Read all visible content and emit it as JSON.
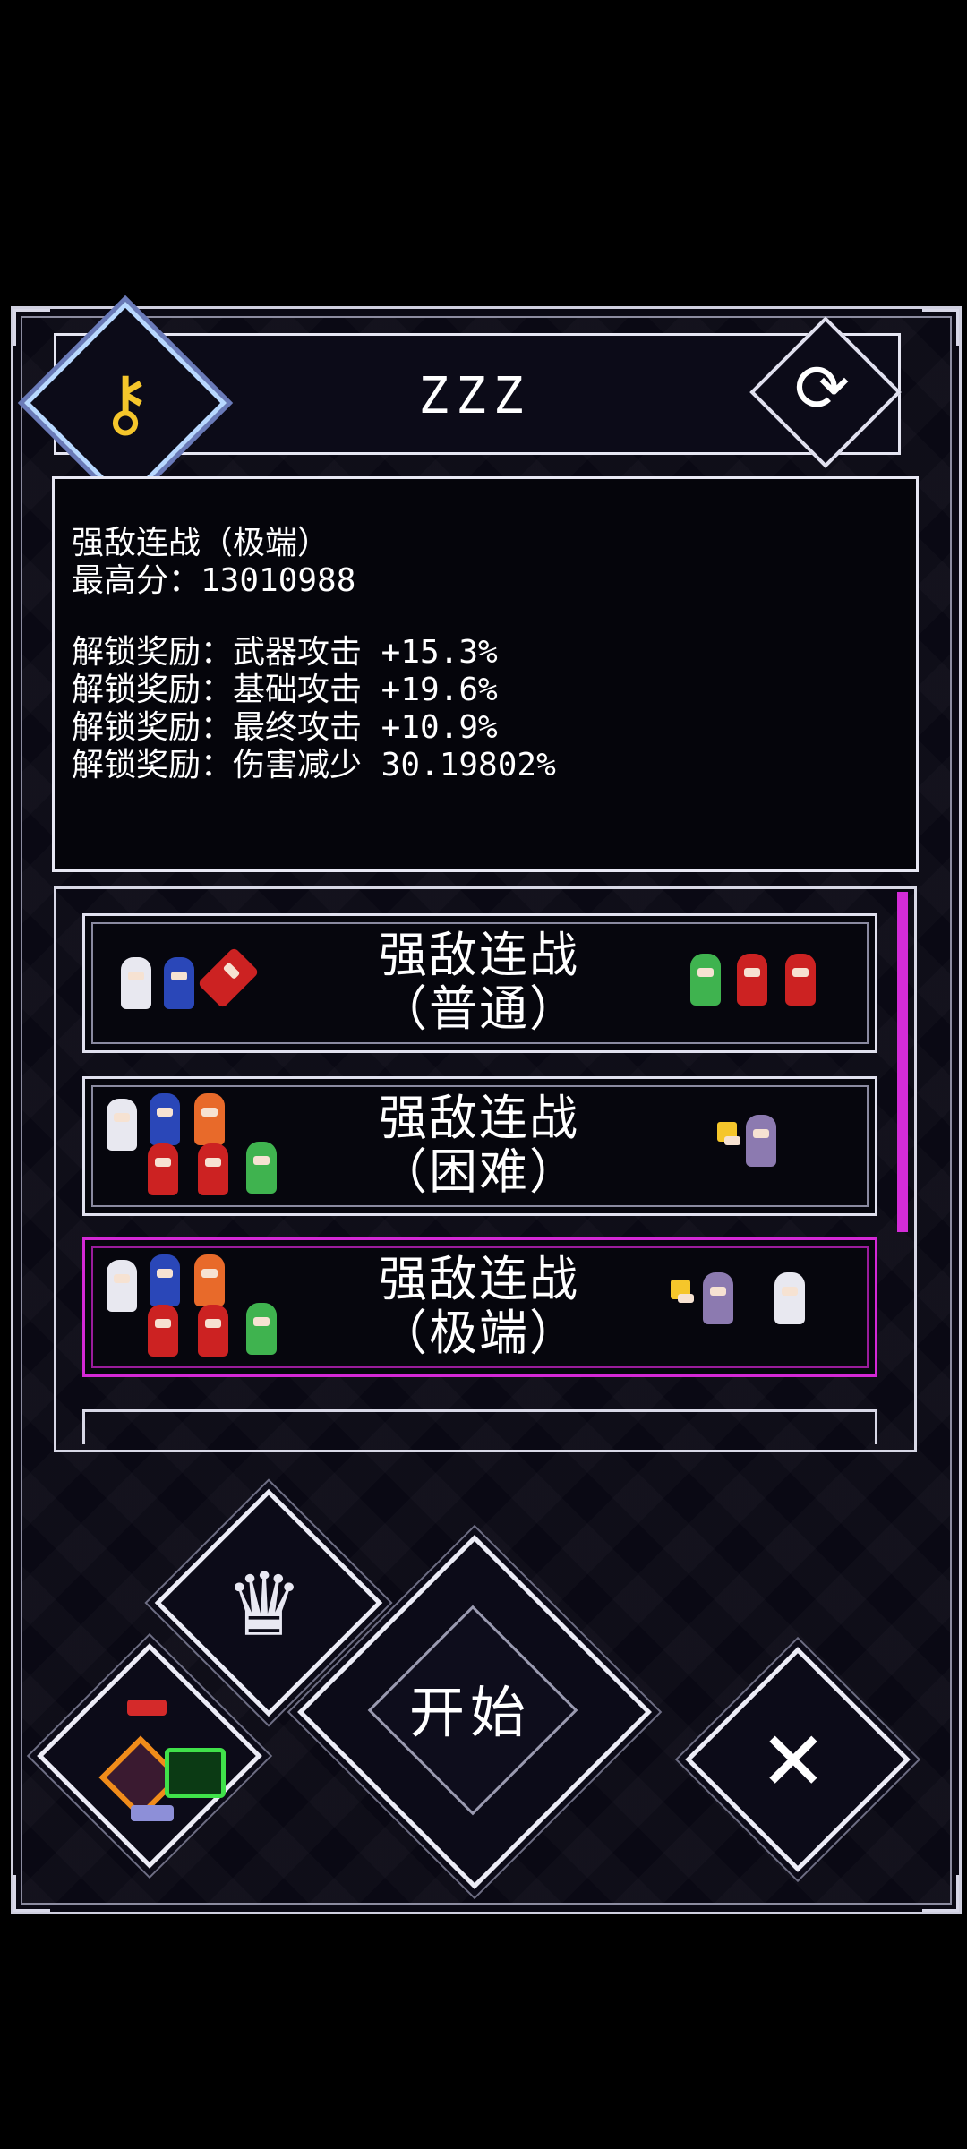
{
  "header": {
    "title": "ZZZ",
    "key_icon": "key-icon",
    "refresh_icon": "refresh-icon"
  },
  "info": {
    "lines": [
      "强敌连战（极端）",
      "最高分：13010988",
      "",
      "解锁奖励：武器攻击 +15.3%",
      "解锁奖励：基础攻击 +19.6%",
      "解锁奖励：最终攻击 +10.9%",
      "解锁奖励：伤害减少 30.19802%"
    ]
  },
  "modes": [
    {
      "line1": "强敌连战",
      "line2": "（普通）",
      "selected": false
    },
    {
      "line1": "强敌连战",
      "line2": "（困难）",
      "selected": false
    },
    {
      "line1": "强敌连战",
      "line2": "（极端）",
      "selected": true
    }
  ],
  "buttons": {
    "start_label": "开始",
    "crown_icon": "crown-icon",
    "equipment_icon": "equipment-icon",
    "swords_icon": "crossed-swords-icon"
  },
  "colors": {
    "accent_selected": "#d428d6",
    "frame": "#e0e0ee",
    "background": "#0a0914"
  }
}
